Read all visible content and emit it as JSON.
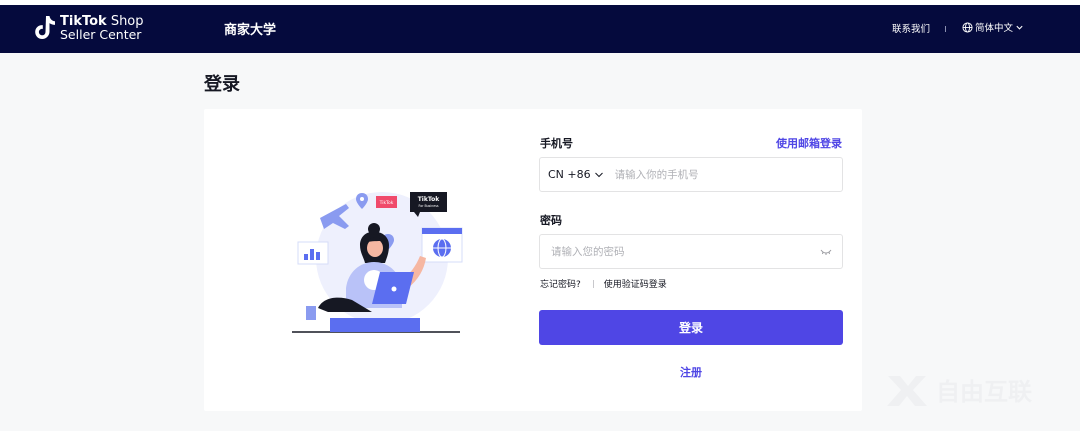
{
  "header": {
    "logo_line1_bold": "TikTok",
    "logo_line1_rest": " Shop",
    "logo_line2": "Seller Center",
    "nav_link": "商家大学",
    "contact": "联系我们",
    "language": "简体中文"
  },
  "page": {
    "title": "登录"
  },
  "illustration": {
    "tiktok_card_line1": "TikTok",
    "tiktok_card_line2": "For Business",
    "pink_tag": "TikTok"
  },
  "form": {
    "phone_label": "手机号",
    "email_login_link": "使用邮箱登录",
    "country_code": "CN +86",
    "phone_placeholder": "请输入你的手机号",
    "password_label": "密码",
    "password_placeholder": "请输入您的密码",
    "forgot_password": "忘记密码?",
    "code_login": "使用验证码登录",
    "login_button": "登录",
    "register_link": "注册"
  },
  "watermark": {
    "text": "自由互联"
  },
  "colors": {
    "navbar": "#050a3d",
    "accent": "#4f46e5",
    "background": "#f7f8f9"
  }
}
